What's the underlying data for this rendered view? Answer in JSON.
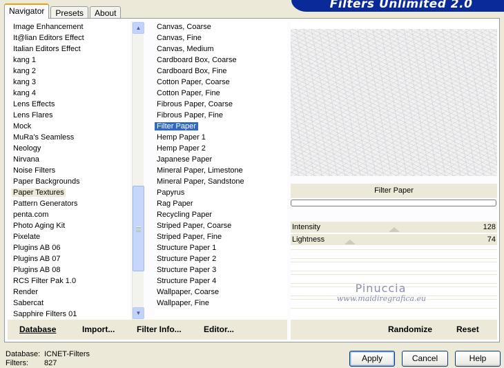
{
  "tabs": [
    "Navigator",
    "Presets",
    "About"
  ],
  "app_title": "Filters Unlimited 2.0",
  "categories": [
    "Image Enhancement",
    "It@lian Editors Effect",
    "Italian Editors Effect",
    "kang 1",
    "kang 2",
    "kang 3",
    "kang 4",
    "Lens Effects",
    "Lens Flares",
    "Mock",
    "MuRa's Seamless",
    "Neology",
    "Nirvana",
    "Noise Filters",
    "Paper Backgrounds",
    "Paper Textures",
    "Pattern Generators",
    "penta.com",
    "Photo Aging Kit",
    "Pixelate",
    "Plugins AB 06",
    "Plugins AB 07",
    "Plugins AB 08",
    "RCS Filter Pak 1.0",
    "Render",
    "Sabercat",
    "Sapphire Filters 01"
  ],
  "selected_category": "Paper Textures",
  "filters": [
    "Canvas, Coarse",
    "Canvas, Fine",
    "Canvas, Medium",
    "Cardboard Box, Coarse",
    "Cardboard Box, Fine",
    "Cotton Paper, Coarse",
    "Cotton Paper, Fine",
    "Fibrous Paper, Coarse",
    "Fibrous Paper, Fine",
    "Filter Paper",
    "Hemp Paper 1",
    "Hemp Paper 2",
    "Japanese Paper",
    "Mineral Paper, Limestone",
    "Mineral Paper, Sandstone",
    "Papyrus",
    "Rag Paper",
    "Recycling Paper",
    "Striped Paper, Coarse",
    "Striped Paper, Fine",
    "Structure Paper 1",
    "Structure Paper 2",
    "Structure Paper 3",
    "Structure Paper 4",
    "Wallpaper, Coarse",
    "Wallpaper, Fine"
  ],
  "selected_filter": "Filter Paper",
  "preview": {
    "filter_name": "Filter Paper",
    "progress": 0
  },
  "parameters": [
    {
      "label": "Intensity",
      "value": "128"
    },
    {
      "label": "Lightness",
      "value": "74"
    }
  ],
  "watermark": {
    "line1": "Pinuccia",
    "line2": "www.maidiregrafica.eu"
  },
  "links": {
    "database": "Database",
    "import": "Import...",
    "filter_info": "Filter Info...",
    "editor": "Editor...",
    "randomize": "Randomize",
    "reset": "Reset"
  },
  "status": {
    "database_label": "Database:",
    "database_value": "ICNET-Filters",
    "filters_label": "Filters:",
    "filters_value": "827"
  },
  "buttons": {
    "apply": "Apply",
    "cancel": "Cancel",
    "help": "Help"
  },
  "colors": {
    "banner": "#0b2a9a",
    "selection": "#316ac5",
    "background": "#ece9d8",
    "tab_highlight": "#e6a010"
  }
}
